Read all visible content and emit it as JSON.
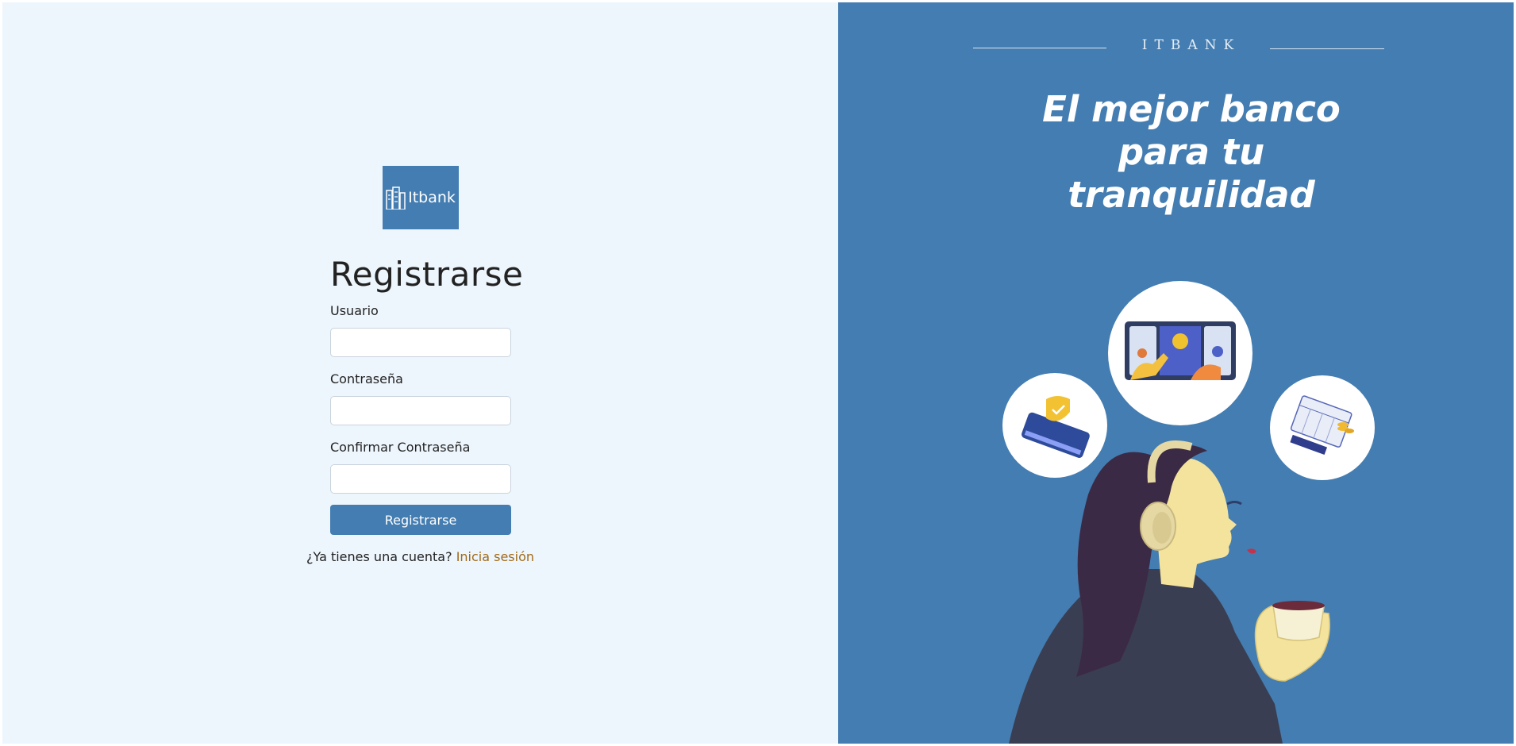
{
  "form": {
    "logo_text": "Itbank",
    "title": "Registrarse",
    "fields": [
      {
        "label": "Usuario",
        "value": ""
      },
      {
        "label": "Contraseña",
        "value": ""
      },
      {
        "label": "Confirmar Contraseña",
        "value": ""
      }
    ],
    "submit_label": "Registrarse",
    "footer_text": "¿Ya tienes una cuenta?",
    "footer_link": "Inicia sesión"
  },
  "promo": {
    "brand": "ITBANK",
    "headline_lines": [
      "El mejor banco",
      "para tu",
      "tranquilidad"
    ]
  },
  "colors": {
    "primary": "#447db1",
    "left_bg": "#eef6fd",
    "link": "#a06a19"
  },
  "icons": [
    "building-logo-icon",
    "money-transfer-illustration",
    "shield-card-illustration",
    "calendar-payment-illustration",
    "woman-headphones-illustration"
  ]
}
